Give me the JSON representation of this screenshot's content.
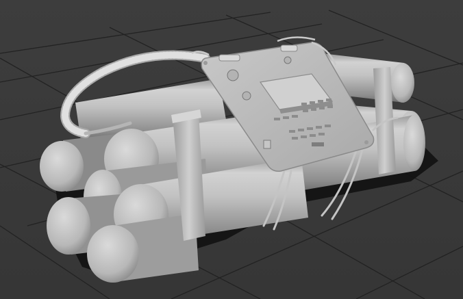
{
  "scene": {
    "background_color": "#3c3c3c",
    "grid_color": "#202020",
    "model_color": "#bdbdbd",
    "shadow_color": "#111111"
  }
}
